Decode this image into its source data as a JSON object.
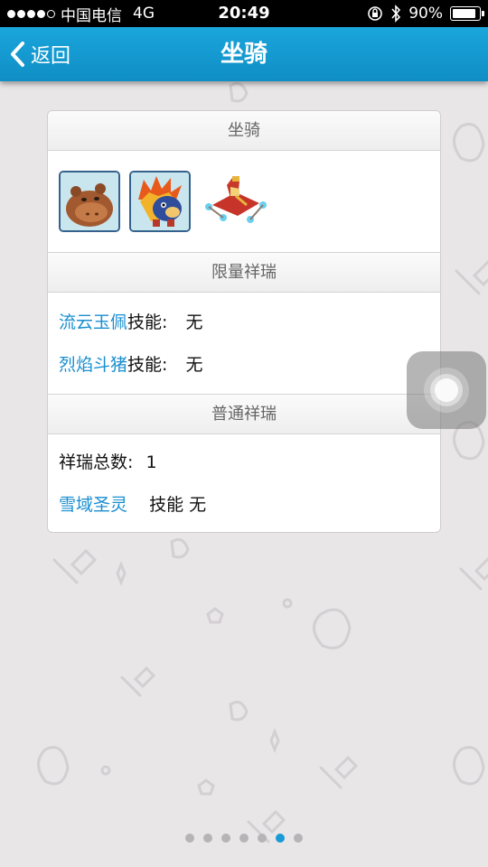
{
  "status_bar": {
    "carrier": "中国电信",
    "network": "4G",
    "time": "20:49",
    "battery": "90%",
    "battery_level": 0.9
  },
  "nav": {
    "back_label": "返回",
    "title": "坐骑"
  },
  "sections": {
    "mounts_header": "坐骑",
    "limited_header": "限量祥瑞",
    "normal_header": "普通祥瑞"
  },
  "limited": [
    {
      "name": "流云玉佩",
      "skill_label": "技能:",
      "skill_value": "无"
    },
    {
      "name": "烈焰斗猪",
      "skill_label": "技能:",
      "skill_value": "无"
    }
  ],
  "normal": {
    "count_label": "祥瑞总数:",
    "count_value": "1",
    "item_name": "雪域圣灵",
    "item_skill_label": "技能",
    "item_skill_value": "无"
  },
  "pager": {
    "total": 7,
    "active_index": 5
  },
  "colors": {
    "accent": "#1a9ad6",
    "link": "#1a8fd0",
    "navbar": "#1aa6dc"
  },
  "icons": [
    "back-chevron-icon",
    "lock-rotation-icon",
    "bluetooth-icon",
    "battery-icon",
    "assistive-touch-icon"
  ]
}
